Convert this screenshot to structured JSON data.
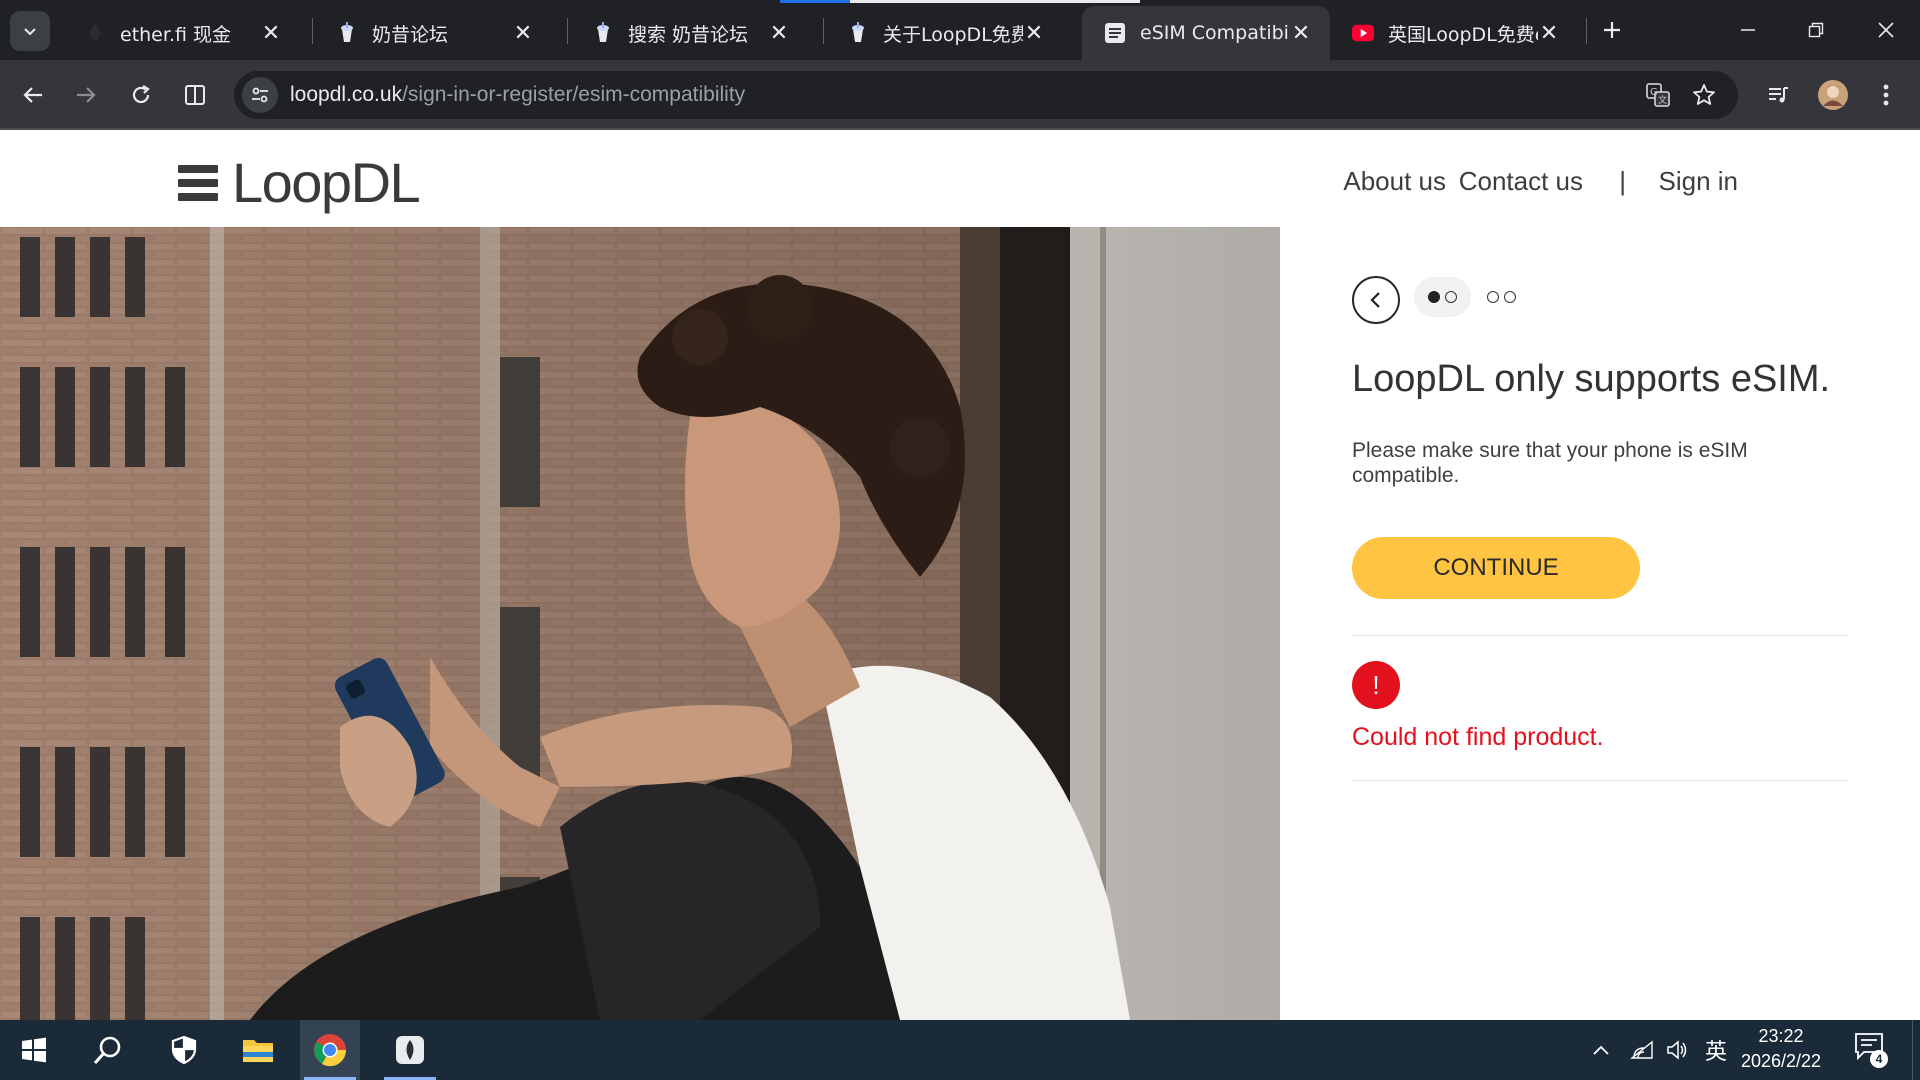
{
  "browser": {
    "tabs": [
      {
        "title": "ether.fi 现金",
        "favicon": "etherfi-icon"
      },
      {
        "title": "奶昔论坛",
        "favicon": "milkshake-icon"
      },
      {
        "title": "搜索 奶昔论坛",
        "favicon": "milkshake-icon"
      },
      {
        "title": "关于LoopDL免费e",
        "favicon": "milkshake-icon"
      },
      {
        "title": "eSIM Compatibili",
        "favicon": "page-icon",
        "active": true
      },
      {
        "title": "英国LoopDL免费e",
        "favicon": "youtube-icon"
      }
    ],
    "url": {
      "host": "loopdl.co.uk",
      "path": "/sign-in-or-register/esim-compatibility"
    }
  },
  "site": {
    "logo_text": "LoopDL",
    "nav": {
      "about": "About us",
      "contact": "Contact us",
      "separator": "|",
      "signin": "Sign in"
    }
  },
  "panel": {
    "title": "LoopDL only supports eSIM.",
    "description": "Please make sure that your phone is eSIM compatible.",
    "continue_label": "CONTINUE",
    "error_symbol": "!",
    "error_message": "Could not find product.",
    "steps": {
      "current": 1,
      "total": 4
    }
  },
  "taskbar": {
    "ime": "英",
    "time": "23:22",
    "date": "2026/2/22",
    "notifications": "4"
  },
  "colors": {
    "accent_yellow": "#ffc542",
    "error_red": "#e3101d",
    "chrome_dark": "#1f2125",
    "taskbar": "#1b2a38"
  }
}
